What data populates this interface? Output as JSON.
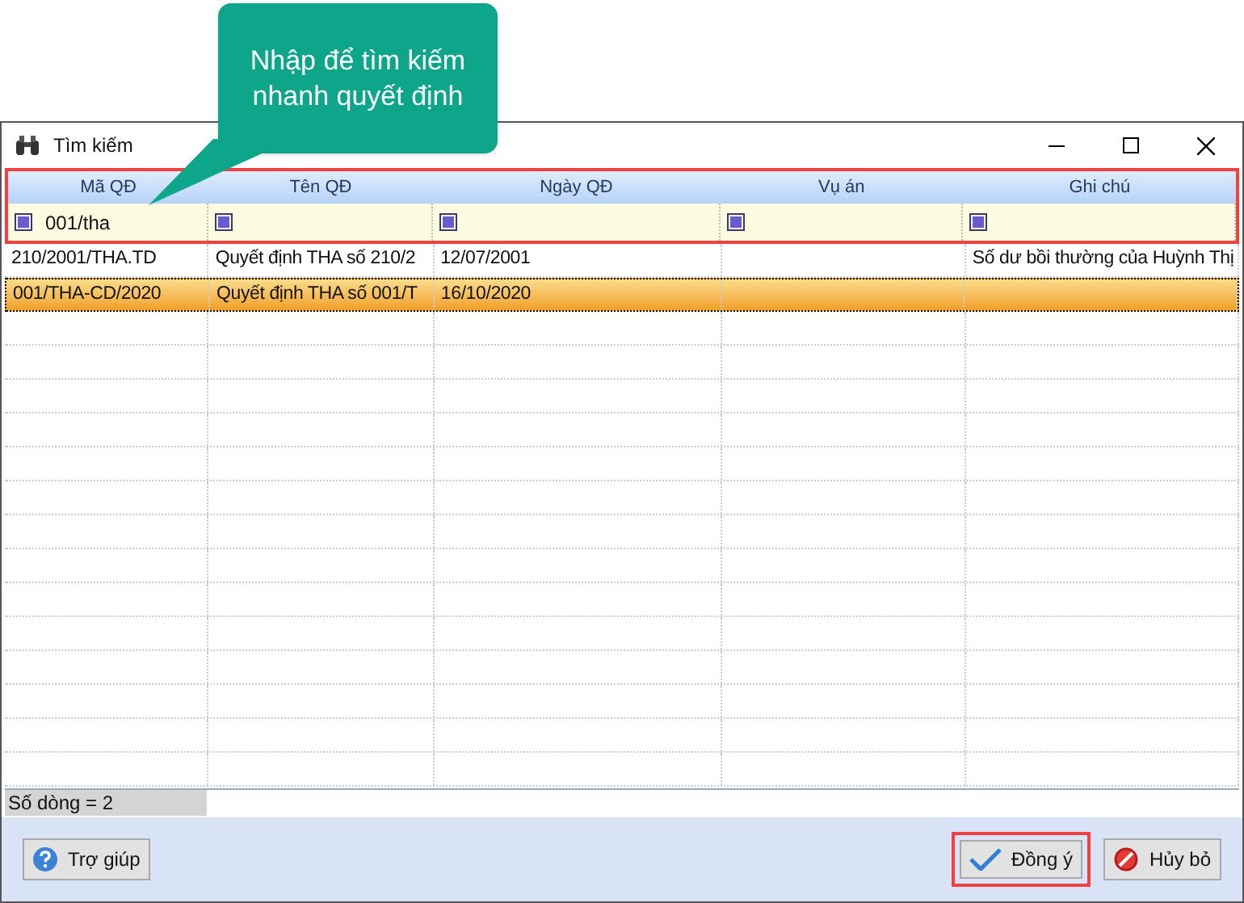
{
  "callout": {
    "text": "Nhập để tìm kiếm nhanh quyết định"
  },
  "window": {
    "title": "Tìm kiếm"
  },
  "filter_panel": {
    "highlighted": true
  },
  "columns": [
    {
      "label": "Mã QĐ",
      "filter": "001/tha"
    },
    {
      "label": "Tên QĐ"
    },
    {
      "label": "Ngày QĐ"
    },
    {
      "label": "Vụ án"
    },
    {
      "label": "Ghi chú"
    }
  ],
  "rows": [
    {
      "cells": [
        "210/2001/THA.TD",
        "Quyết định THA số 210/2",
        "12/07/2001",
        null,
        "Số dư bồi thường của Huỳnh Thị"
      ],
      "selected": false
    },
    {
      "cells": [
        "001/THA-CD/2020",
        "Quyết định THA số 001/T",
        "16/10/2020",
        null,
        null
      ],
      "selected": true
    }
  ],
  "status_bar": {
    "text": "Số dòng = 2"
  },
  "buttons": [
    {
      "kind": "help",
      "label": "Trợ giúp",
      "highlighted": false
    },
    {
      "kind": "ok",
      "label": "Đồng ý",
      "highlighted": true
    },
    {
      "kind": "cancel",
      "label": "Hủy bỏ",
      "highlighted": false
    }
  ]
}
